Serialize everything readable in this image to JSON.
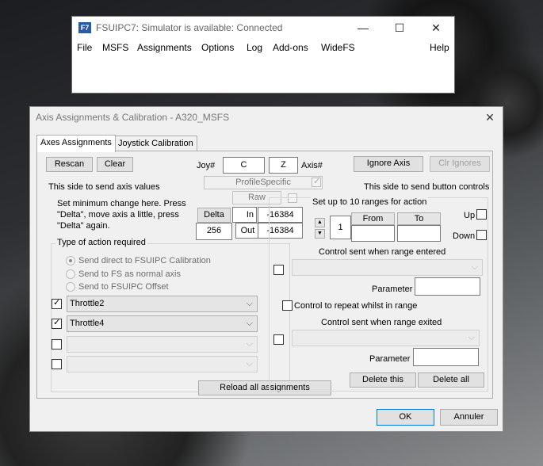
{
  "main_window": {
    "title": "FSUIPC7: Simulator is available: Connected",
    "icon": "fsuipc-app-icon",
    "caption_buttons": {
      "minimize": "—",
      "maximize": "☐",
      "close": "✕"
    },
    "menu": [
      "File",
      "MSFS",
      "Assignments",
      "Options",
      "Log",
      "Add-ons",
      "WideFS",
      "Help"
    ]
  },
  "dialog": {
    "title": "Axis Assignments & Calibration - A320_MSFS",
    "close": "✕",
    "tabs": [
      "Axes Assignments",
      "Joystick Calibration"
    ],
    "buttons": {
      "rescan": "Rescan",
      "clear": "Clear",
      "ignore_axis": "Ignore Axis",
      "clr_ignores": "Clr Ignores",
      "delta": "Delta",
      "reload_all": "Reload all assignments",
      "delete_this": "Delete this",
      "delete_all": "Delete all",
      "ok": "OK",
      "cancel": "Annuler"
    },
    "joy_label": "Joy#",
    "joy_value": "C",
    "axis_value": "Z",
    "axis_label": "Axis#",
    "profile_specific": "ProfileSpecific",
    "raw_label": "Raw",
    "left_heading": "This side to send axis values",
    "right_heading": "This side to send button controls",
    "min_change_text": [
      "Set minimum change  here.  Press",
      "\"Delta\", move axis a little,  press",
      "\"Delta\" again."
    ],
    "delta_value": "256",
    "in_label": "In",
    "in_value": "-16384",
    "out_label": "Out",
    "out_value": "-16384",
    "ranges_label": "Set up to 10 ranges for action",
    "range_count": "1",
    "from_label": "From",
    "to_label": "To",
    "up_label": "Up",
    "down_label": "Down",
    "action_group": "Type of action required",
    "radio_options": [
      "Send direct to FSUIPC Calibration",
      "Send to FS as normal axis",
      "Send to FSUIPC Offset"
    ],
    "axis_rows": [
      {
        "checked": true,
        "value": "Throttle2"
      },
      {
        "checked": true,
        "value": "Throttle4"
      },
      {
        "checked": false,
        "value": ""
      },
      {
        "checked": false,
        "value": ""
      }
    ],
    "control_entered_label": "Control sent when range entered",
    "parameter_label": "Parameter",
    "repeat_label": "Control to repeat whilst in range",
    "control_exited_label": "Control sent when range exited"
  }
}
